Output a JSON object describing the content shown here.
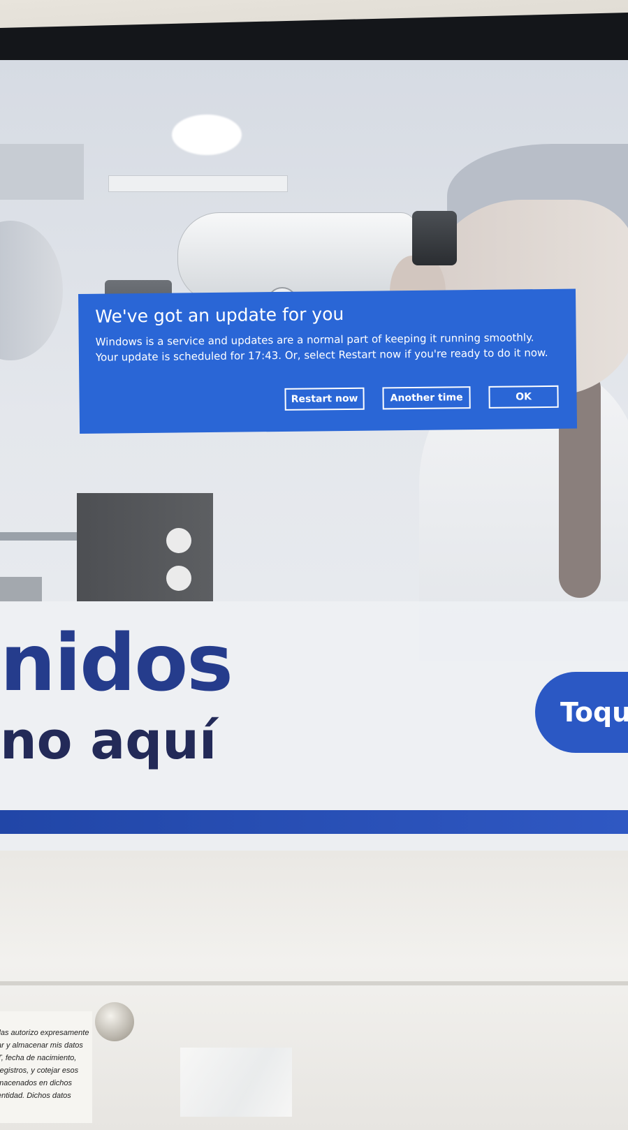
{
  "dialog": {
    "title": "We've got an update for you",
    "message": "Windows is a service and updates are a normal part of keeping it running smoothly. Your update is scheduled for 17:43. Or, select Restart now if you're ready to do it now.",
    "buttons": {
      "restart_now": "Restart now",
      "another_time": "Another time",
      "ok": "OK"
    },
    "accent_color": "#2a66d6"
  },
  "kiosk": {
    "headline_fragment": "nidos",
    "subline_fragment": "no aquí",
    "touch_button_fragment": "Toqu",
    "brand_blue": "#2b58c4"
  },
  "sticker": {
    "lines": [
      "llas autorizo expresamente",
      "ar y almacenar mis datos",
      "T, fecha de nacimiento,",
      "registros, y cotejar esos",
      "macenados en dichos",
      "entidad. Dichos datos"
    ]
  }
}
